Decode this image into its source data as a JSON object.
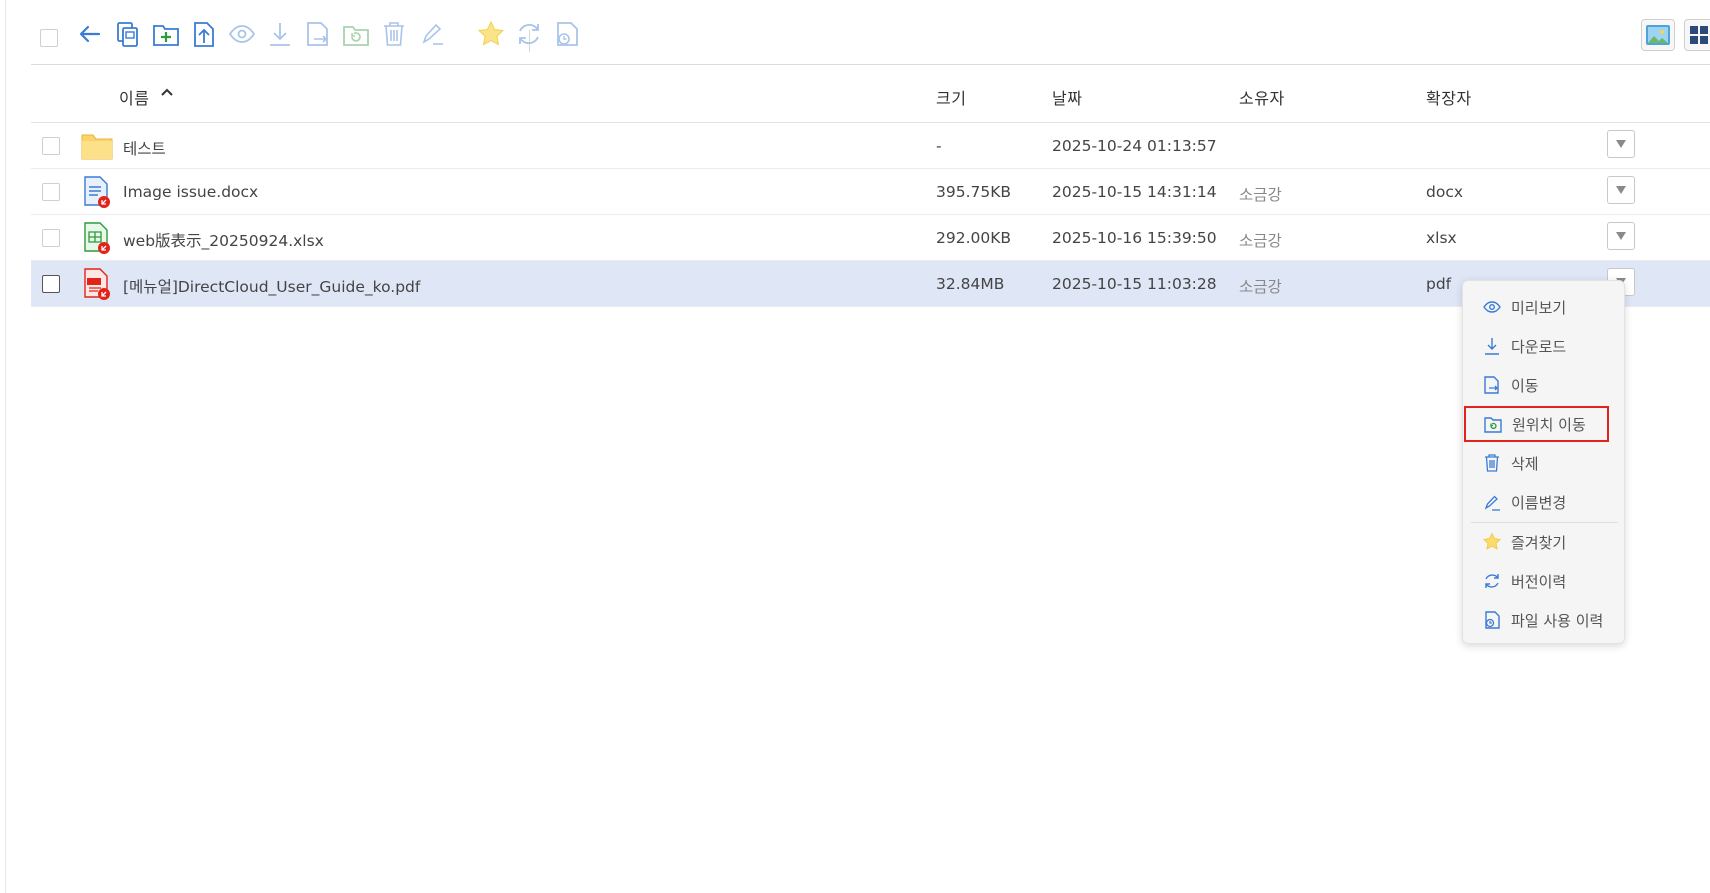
{
  "toolbar": {
    "icons": [
      "back-icon",
      "copy-icon",
      "new-folder-icon",
      "upload-icon",
      "preview-icon",
      "download-icon",
      "move-icon",
      "restore-icon",
      "delete-icon",
      "rename-icon",
      "favorite-icon",
      "version-history-icon",
      "usage-history-icon"
    ]
  },
  "view_toggle": [
    "thumbnail-view-icon",
    "grid-view-icon"
  ],
  "table": {
    "headers": {
      "name": "이름",
      "size": "크기",
      "date": "날짜",
      "owner": "소유자",
      "ext": "확장자"
    },
    "rows": [
      {
        "name": "테스트",
        "size": "-",
        "date": "2025-10-24 01:13:57",
        "owner": "",
        "ext": "",
        "type": "folder"
      },
      {
        "name": "Image issue.docx",
        "size": "395.75KB",
        "date": "2025-10-15 14:31:14",
        "owner": "소금강",
        "ext": "docx",
        "type": "docx"
      },
      {
        "name": "web版表示_20250924.xlsx",
        "size": "292.00KB",
        "date": "2025-10-16 15:39:50",
        "owner": "소금강",
        "ext": "xlsx",
        "type": "xlsx"
      },
      {
        "name": "[메뉴얼]DirectCloud_User_Guide_ko.pdf",
        "size": "32.84MB",
        "date": "2025-10-15 11:03:28",
        "owner": "소금강",
        "ext": "pdf",
        "type": "pdf"
      }
    ]
  },
  "context_menu": {
    "items": [
      {
        "label": "미리보기",
        "icon": "preview-icon"
      },
      {
        "label": "다운로드",
        "icon": "download-icon"
      },
      {
        "label": "이동",
        "icon": "move-icon"
      },
      {
        "label": "원위치 이동",
        "icon": "restore-icon"
      },
      {
        "label": "삭제",
        "icon": "delete-icon"
      },
      {
        "label": "이름변경",
        "icon": "rename-icon"
      },
      {
        "label": "즐겨찾기",
        "icon": "favorite-icon"
      },
      {
        "label": "버전이력",
        "icon": "version-history-icon"
      },
      {
        "label": "파일 사용 이력",
        "icon": "usage-history-icon"
      }
    ]
  },
  "colors": {
    "accent": "#3a7bd5",
    "highlight": "#e2231a",
    "selected_row": "#dfe7f7",
    "star": "#f5c518"
  }
}
